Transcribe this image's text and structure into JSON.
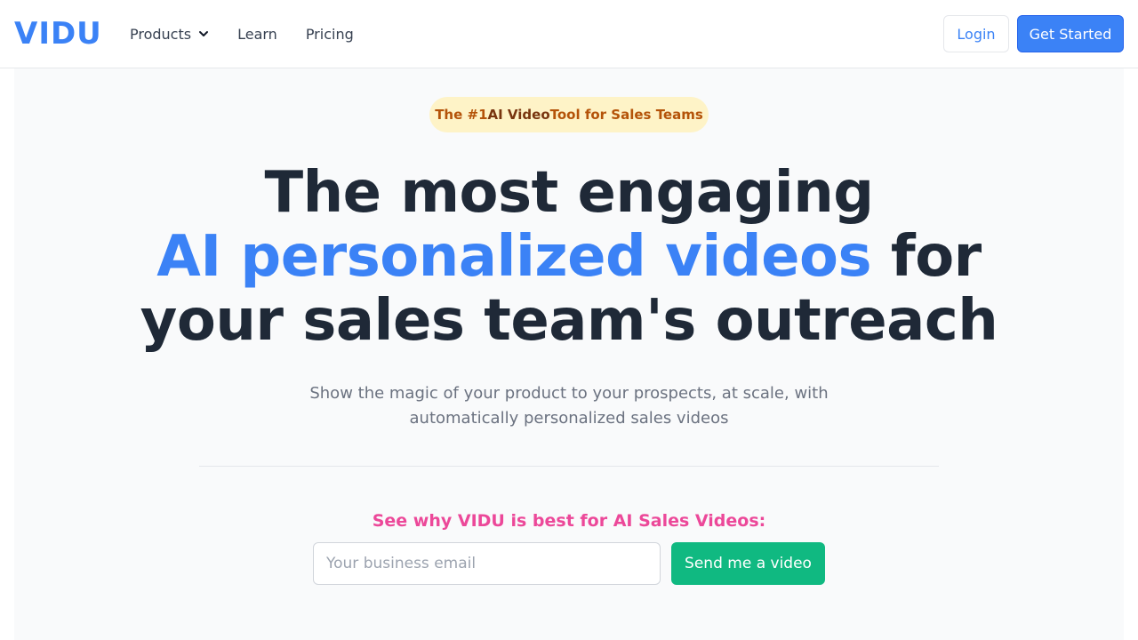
{
  "header": {
    "logo": "VIDU",
    "nav": {
      "products": "Products",
      "learn": "Learn",
      "pricing": "Pricing"
    },
    "login_label": "Login",
    "get_started_label": "Get Started"
  },
  "hero": {
    "badge": {
      "part1": "The #1 ",
      "part2": "AI Video",
      "part3": " Tool for Sales Teams"
    },
    "headline": {
      "line1": "The most engaging",
      "line2_accent": "AI personalized videos",
      "line2_rest": " for",
      "line3": "your sales team's outreach"
    },
    "subtext": "Show the magic of your product to your prospects, at scale, with automatically personalized sales videos",
    "cta_heading": "See why VIDU is best for AI Sales Videos:",
    "email_placeholder": "Your business email",
    "send_label": "Send me a video"
  },
  "colors": {
    "brand": "#3b82f6",
    "cta_pink": "#ec4899",
    "send_green": "#10b981",
    "badge_bg": "#fef3c7",
    "badge_text": "#b45309"
  },
  "icons": {
    "products_dropdown": "chevron-down-icon"
  }
}
